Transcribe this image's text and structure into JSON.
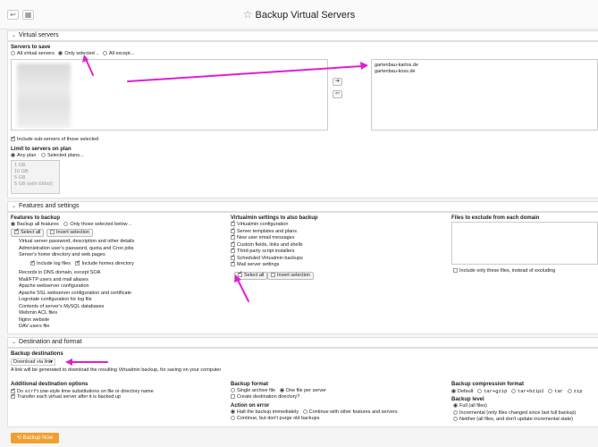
{
  "header": {
    "title": "Backup Virtual Servers",
    "back_icon": "return-arrow-icon",
    "grid_icon": "grid-icon",
    "star_icon": "star-icon"
  },
  "virtual_servers": {
    "section_title": "Virtual servers",
    "servers_to_save_label": "Servers to save",
    "radio_options": [
      "All virtual servers",
      "Only selected ..",
      "All except..."
    ],
    "selected_option": "Only selected ..",
    "selected_domains": [
      "gartenbau-karlos.de",
      "gartenbau-koss.de"
    ],
    "include_subservers": "Include sub-servers of those selected",
    "limit_label": "Limit to servers on plan",
    "plan_options": [
      "Any plan",
      "Selected plans..."
    ],
    "plans": [
      "1 GB",
      "10 GB",
      "5 GB",
      "5 GB (with EMail)"
    ]
  },
  "features": {
    "section_title": "Features and settings",
    "features_label": "Features to backup",
    "feature_radios": [
      "Backup all features",
      "Only those selected below .."
    ],
    "select_all": "Select all",
    "invert_selection": "Invert selection",
    "feature_items": [
      "Virtual server password, description and other details",
      "Administration user's password, quota and Cron jobs",
      "Server's home directory and web pages"
    ],
    "sub_options": [
      "Include log files",
      "Include homes directory"
    ],
    "feature_items2": [
      "Records in DNS domain, except SOA",
      "Mail/FTP users and mail aliases",
      "Apache webserver configuration",
      "Apache SSL webserver configuration and certificate",
      "Logrotate configuration for log file",
      "Contents of server's MySQL databases",
      "Webmin ACL files",
      "Nginx website",
      "DAV users file"
    ],
    "virtualmin_label": "Virtualmin settings to also backup",
    "virtualmin_items": [
      "Virtualmin configuration",
      "Server templates and plans",
      "New user email messages",
      "Custom fields, links and shells",
      "Third-party script installers",
      "Scheduled Virtualmin backups",
      "Mail server settings"
    ],
    "vm_select_all": "Select all",
    "vm_invert": "Invert selection",
    "exclude_label": "Files to exclude from each domain",
    "exclude_only": "Include only these files, instead of excluding"
  },
  "destination": {
    "section_title": "Destination and format",
    "dest_label": "Backup destinations",
    "dest_value": "Download via link",
    "dest_note": "A link will be generated to download the resulting Virtualmin backup, for saving on your computer",
    "additional_label": "Additional destination options",
    "opt1_pre": "Do ",
    "opt1_code": "strftime",
    "opt1_post": "-style time substitutions on file or directory name",
    "opt2": "Transfer each virtual server after it is backed up",
    "format_label": "Backup format",
    "format_opts": [
      "Single archive file",
      "One file per server"
    ],
    "create_dir": "Create destination directory?",
    "error_label": "Action on error",
    "error_opts": [
      "Halt the backup immediately",
      "Continue with other features and servers",
      "Continue, but don't purge old backups"
    ],
    "compression_label": "Backup compression format",
    "compression_opts": [
      "Default",
      "tar+gzip",
      "tar+bzip2",
      "tar",
      "zip"
    ],
    "level_label": "Backup level",
    "level_opts": [
      "Full (all files)",
      "Incremental (only files changed since last full backup)",
      "Neither (all files, and don't update incremental state)"
    ]
  },
  "footer": {
    "backup_now": "Backup Now",
    "backup_icon": "backup-icon"
  },
  "colors": {
    "accent": "#f0a030",
    "annotation": "#e020d0"
  }
}
